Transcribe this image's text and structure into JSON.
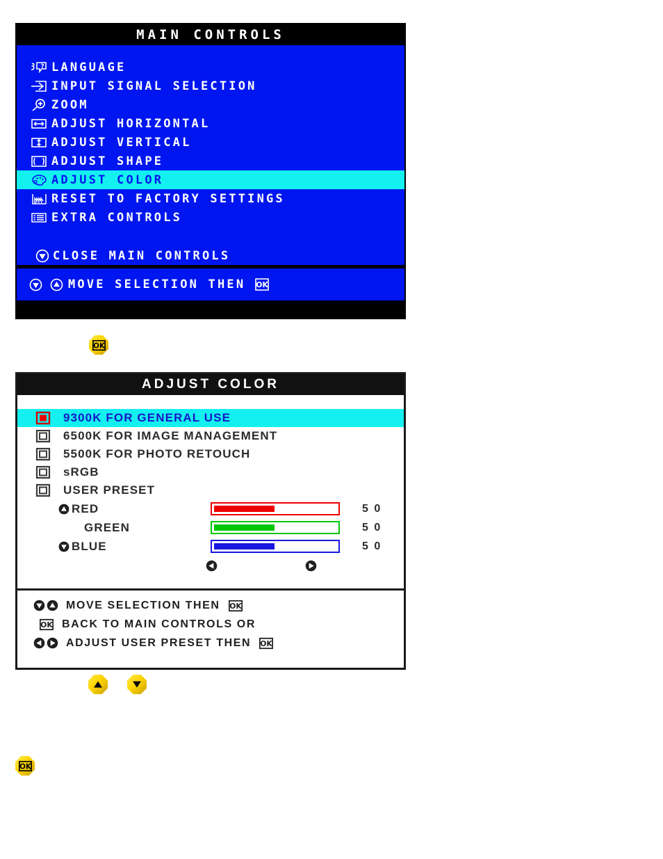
{
  "main_controls": {
    "title": "MAIN CONTROLS",
    "items": [
      {
        "icon": "language-icon",
        "label": "LANGUAGE",
        "selected": false
      },
      {
        "icon": "input-signal-icon",
        "label": "INPUT SIGNAL SELECTION",
        "selected": false
      },
      {
        "icon": "zoom-icon",
        "label": "ZOOM",
        "selected": false
      },
      {
        "icon": "adjust-horizontal-icon",
        "label": "ADJUST HORIZONTAL",
        "selected": false
      },
      {
        "icon": "adjust-vertical-icon",
        "label": "ADJUST VERTICAL",
        "selected": false
      },
      {
        "icon": "adjust-shape-icon",
        "label": "ADJUST SHAPE",
        "selected": false
      },
      {
        "icon": "adjust-color-icon",
        "label": "ADJUST COLOR",
        "selected": true
      },
      {
        "icon": "reset-factory-icon",
        "label": "RESET TO FACTORY SETTINGS",
        "selected": false
      },
      {
        "icon": "extra-controls-icon",
        "label": "EXTRA CONTROLS",
        "selected": false
      }
    ],
    "close_item": {
      "icon": "down-arrow-icon",
      "label": "CLOSE MAIN CONTROLS"
    },
    "footer": {
      "icons": [
        "down-arrow-icon",
        "up-arrow-icon"
      ],
      "label": "MOVE SELECTION THEN",
      "trailing_icon": "ok-icon"
    },
    "colors": {
      "background": "#0016f0",
      "titlebar": "#000000",
      "highlight": "#14f0f0",
      "text": "#ffffff",
      "highlight_text": "#0016f0"
    }
  },
  "adjust_color": {
    "title": "ADJUST COLOR",
    "presets": [
      {
        "icon": "radio-selected-icon",
        "label": "9300K FOR GENERAL USE",
        "selected": true
      },
      {
        "icon": "radio-icon",
        "label": "6500K FOR IMAGE MANAGEMENT",
        "selected": false
      },
      {
        "icon": "radio-icon",
        "label": "5500K FOR PHOTO RETOUCH",
        "selected": false
      },
      {
        "icon": "radio-icon",
        "label": "sRGB",
        "selected": false
      },
      {
        "icon": "radio-icon",
        "label": "USER PRESET",
        "selected": false
      }
    ],
    "sliders": [
      {
        "arrow_icon": "up-arrow-icon",
        "name": "RED",
        "value": "5 0",
        "percent": 48,
        "color": "#ee0000"
      },
      {
        "arrow_icon": "",
        "name": "GREEN",
        "value": "5 0",
        "percent": 48,
        "color": "#00c800"
      },
      {
        "arrow_icon": "down-arrow-icon",
        "name": "BLUE",
        "value": "5 0",
        "percent": 48,
        "color": "#1717e0"
      }
    ],
    "nudge": {
      "left_icon": "left-arrow-icon",
      "right_icon": "right-arrow-icon"
    },
    "footer": [
      {
        "icons": [
          "down-arrow-icon",
          "up-arrow-icon"
        ],
        "label": "MOVE SELECTION THEN",
        "trailing_icon": "ok-icon"
      },
      {
        "icons": [
          "ok-icon"
        ],
        "label": "BACK TO MAIN CONTROLS OR",
        "trailing_icon": ""
      },
      {
        "icons": [
          "left-arrow-icon",
          "right-arrow-icon"
        ],
        "label": "ADJUST USER PRESET THEN",
        "trailing_icon": "ok-icon"
      }
    ],
    "colors": {
      "background": "#ffffff",
      "titlebar": "#111111",
      "highlight": "#14f0f0",
      "text": "#2b2b2b",
      "highlight_text": "#1717c8"
    }
  },
  "buttons": {
    "ok_between_panels": {
      "icon": "ok-icon",
      "label": "OK"
    },
    "up": {
      "icon": "up-arrow-icon",
      "label": "UP"
    },
    "down": {
      "icon": "down-arrow-icon",
      "label": "DOWN"
    },
    "ok_bottom": {
      "icon": "ok-icon",
      "label": "OK"
    },
    "color": "#ffd700"
  }
}
